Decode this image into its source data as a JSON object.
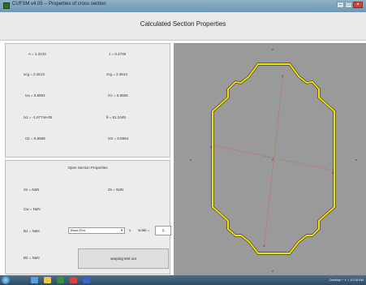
{
  "window": {
    "title": "CUFSM v4.05 -- Properties of cross section",
    "buttons": [
      "–",
      "□",
      "×"
    ]
  },
  "header": {
    "title": "Calculated Section Properties"
  },
  "properties": {
    "A": "A = 1.3133",
    "J": "J = 0.4736",
    "xcg": "xcg = 2.3613",
    "zcg": "zcg = 2.3614",
    "Ixx": "Ixx = 6.5584",
    "Izz": "Izz = 6.5565",
    "Ixz": "Ixz = -1.6774e-05",
    "theta": "θ = 61.2448",
    "I11": "I11 = 6.5565",
    "I22": "I22 = 6.5584"
  },
  "open_section": {
    "title": "Open Section Properties",
    "Xs": "Xs = NaN",
    "Zs": "Zs = NaN",
    "Cw": "Cw = NaN",
    "B1": "B1 = NaN",
    "B2": "B2 = NaN",
    "dropdown_value": "Basic Plot",
    "scale_label": "scale =",
    "scale_value": "1",
    "action_button": "warping test out"
  },
  "plot_labels": {
    "z_top": "z",
    "z_bottom": "z",
    "x_left": "x",
    "x_right": "x",
    "one_top": "1",
    "one_bottom": "1",
    "two_left": "2",
    "two_right": "2",
    "centroid": "C"
  },
  "colors": {
    "plot_bg": "#9a9a9a",
    "section_fill": "#f2e000",
    "principal_axis": "#d9534f",
    "centroid_axis": "#7ec07e"
  },
  "taskbar": {
    "tray_text": "Desktop  ^  ◐  ♪   10:28 AM"
  }
}
